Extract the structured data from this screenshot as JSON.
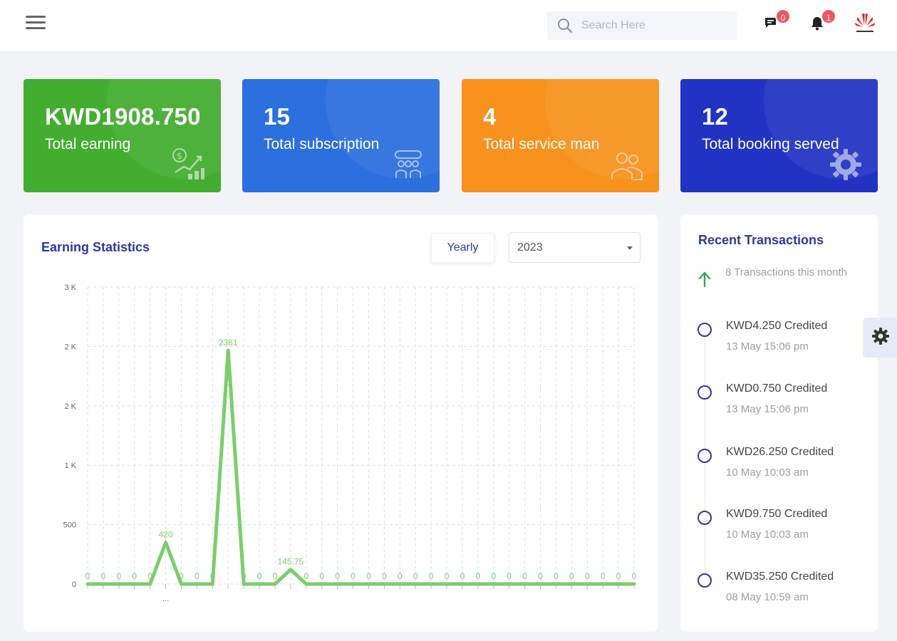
{
  "header": {
    "search_placeholder": "Search Here",
    "messages_count": "0",
    "notifications_count": "1"
  },
  "cards": [
    {
      "value": "KWD1908.750",
      "label": "Total earning",
      "color": "#43ad2f",
      "icon": "earning-growth-icon"
    },
    {
      "value": "15",
      "label": "Total subscription",
      "color": "#2c6fde",
      "icon": "subscription-group-icon"
    },
    {
      "value": "4",
      "label": "Total service man",
      "color": "#f7921e",
      "icon": "service-man-icon"
    },
    {
      "value": "12",
      "label": "Total booking served",
      "color": "#2233c3",
      "icon": "booking-gear-icon"
    }
  ],
  "stats": {
    "title": "Earning Statistics",
    "yearly_label": "Yearly",
    "year_value": "2023"
  },
  "chart_data": {
    "type": "line",
    "y_tick_labels": [
      "0",
      "500",
      "1 K",
      "2 K",
      "2 K",
      "3 K"
    ],
    "ylim": [
      0,
      3000
    ],
    "grid": true,
    "line_color": "#7ccd6b",
    "x_tick_label": "...",
    "values": [
      0,
      0,
      0,
      0,
      0,
      420,
      0,
      0,
      0,
      2361,
      0,
      0,
      0,
      145.75,
      0,
      0,
      0,
      0,
      0,
      0,
      0,
      0,
      0,
      0,
      0,
      0,
      0,
      0,
      0,
      0,
      0,
      0,
      0,
      0,
      0,
      0
    ],
    "data_labels": [
      "0",
      "0",
      "0",
      "0",
      "0",
      "420",
      "0",
      "0",
      "0",
      "2361",
      "0",
      "0",
      "0",
      "145.75",
      "0",
      "0",
      "0",
      "0",
      "0",
      "0",
      "0",
      "0",
      "0",
      "0",
      "0",
      "0",
      "0",
      "0",
      "0",
      "0",
      "0",
      "0",
      "0",
      "0",
      "0",
      "0"
    ]
  },
  "transactions": {
    "title": "Recent Transactions",
    "summary": "8 Transactions this month",
    "items": [
      {
        "amount": "KWD4.250 Credited",
        "date": "13 May 15:06 pm"
      },
      {
        "amount": "KWD0.750 Credited",
        "date": "13 May 15:06 pm"
      },
      {
        "amount": "KWD26.250 Credited",
        "date": "10 May 10:03 am"
      },
      {
        "amount": "KWD9.750 Credited",
        "date": "10 May 10:03 am"
      },
      {
        "amount": "KWD35.250 Credited",
        "date": "08 May 10:59 am"
      }
    ]
  }
}
